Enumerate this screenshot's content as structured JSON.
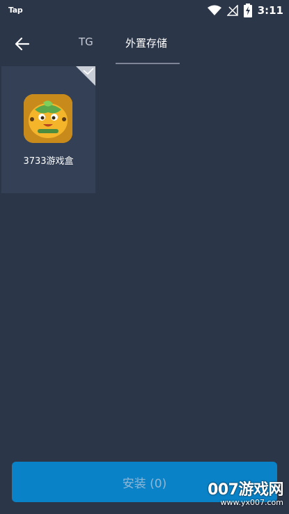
{
  "status_bar": {
    "carrier": "Tap",
    "time": "3:11",
    "icons": [
      "wifi-icon",
      "no-signal-icon",
      "battery-charging-icon"
    ]
  },
  "header": {
    "back_icon": "arrow-left-icon",
    "tabs": [
      {
        "label": "TG",
        "selected": false
      },
      {
        "label": "外置存储",
        "selected": true
      }
    ]
  },
  "apps": [
    {
      "name": "3733游戏盒",
      "icon": "3733-app-icon",
      "checked": true
    }
  ],
  "install_button": {
    "label": "安装 (0)"
  },
  "watermark": {
    "brand": "007游戏网",
    "url": "www.yx007.com"
  },
  "colors": {
    "background": "#2b3649",
    "tile": "#334055",
    "accent": "#0a82c7"
  }
}
